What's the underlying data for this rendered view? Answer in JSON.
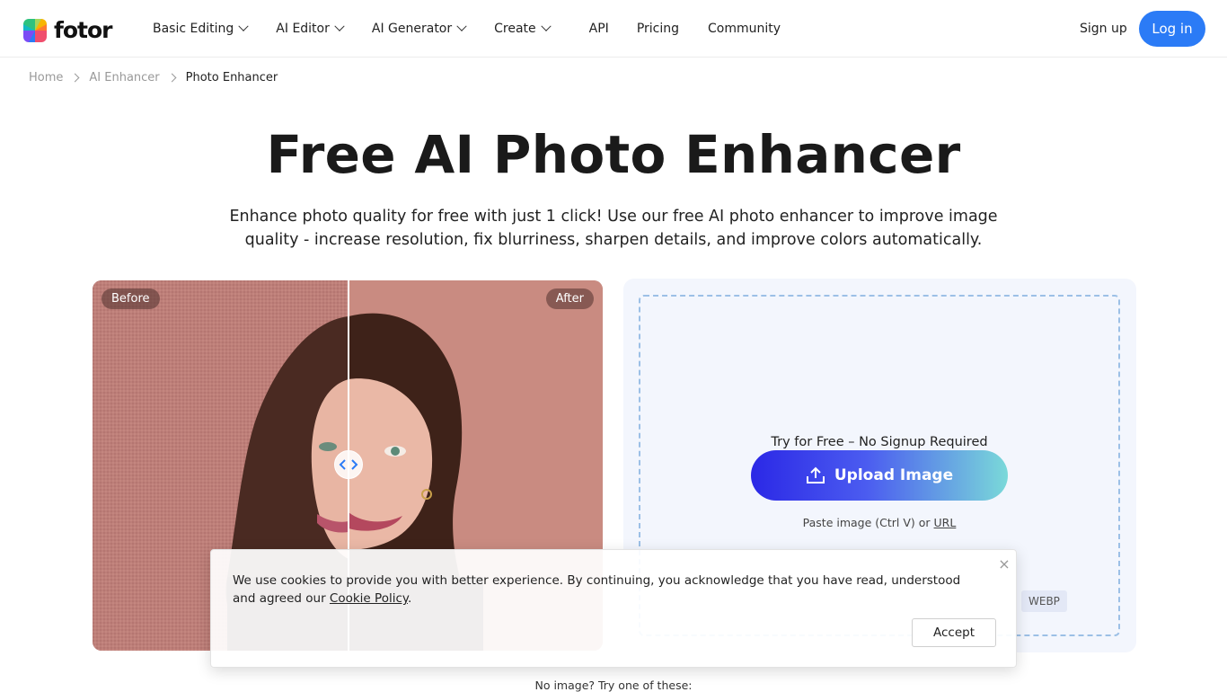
{
  "header": {
    "logo_text": "fotor",
    "nav": [
      {
        "label": "Basic Editing",
        "has_dropdown": true
      },
      {
        "label": "AI Editor",
        "has_dropdown": true
      },
      {
        "label": "AI Generator",
        "has_dropdown": true
      },
      {
        "label": "Create",
        "has_dropdown": true
      },
      {
        "label": "API",
        "has_dropdown": false
      },
      {
        "label": "Pricing",
        "has_dropdown": false
      },
      {
        "label": "Community",
        "has_dropdown": false
      }
    ],
    "signup_label": "Sign up",
    "login_label": "Log in",
    "accent_color": "#2b7bf6"
  },
  "breadcrumb": [
    "Home",
    "AI Enhancer",
    "Photo Enhancer"
  ],
  "hero": {
    "title": "Free AI Photo Enhancer",
    "subtitle": "Enhance photo quality for free with just 1 click! Use our free AI photo enhancer to improve image quality - increase resolution, fix blurriness, sharpen details, and improve colors automatically."
  },
  "compare": {
    "before_label": "Before",
    "after_label": "After",
    "handle_icon": "left-right-chevrons-icon"
  },
  "upload": {
    "try_text": "Try for Free – No Signup Required",
    "button_label": "Upload Image",
    "button_icon": "upload-icon",
    "paste_text": "Paste image (Ctrl V) or ",
    "url_link": "URL",
    "format_visible": "WEBP"
  },
  "bottom_hint": "No image? Try one of these:",
  "cookie": {
    "text": "We use cookies to provide you with better experience. By continuing, you acknowledge that you have read, understood and agreed our ",
    "policy_link": "Cookie Policy",
    "text_end": ".",
    "close_label": "×",
    "accept_label": "Accept"
  }
}
